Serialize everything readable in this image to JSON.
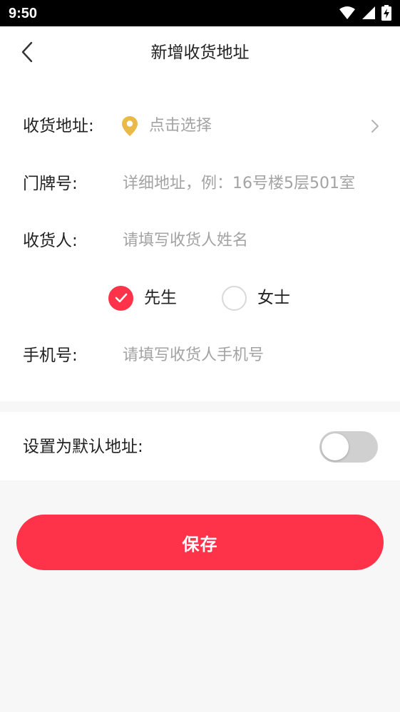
{
  "status_bar": {
    "time": "9:50",
    "icons": [
      "wifi-icon",
      "cell-signal-icon",
      "battery-charging-icon"
    ]
  },
  "header": {
    "back_icon": "chevron-left-icon",
    "title": "新增收货地址"
  },
  "form": {
    "address": {
      "label": "收货地址:",
      "icon": "location-pin-icon",
      "placeholder": "点击选择",
      "value": "",
      "arrow_icon": "chevron-right-icon"
    },
    "door": {
      "label": "门牌号:",
      "placeholder": "详细地址，例：16号楼5层501室",
      "value": ""
    },
    "recipient": {
      "label": "收货人:",
      "placeholder": "请填写收货人姓名",
      "value": ""
    },
    "gender": {
      "selected": "先生",
      "options": [
        "先生",
        "女士"
      ]
    },
    "phone": {
      "label": "手机号:",
      "placeholder": "请填写收货人手机号",
      "value": ""
    }
  },
  "default_address": {
    "label": "设置为默认地址:",
    "enabled": false
  },
  "save_button": {
    "label": "保存"
  },
  "colors": {
    "accent": "#fe3248",
    "pin": "#e9b949",
    "placeholder": "#a3a3a3",
    "page_background": "#f7f7f7",
    "toggle_off": "#d0d0d0"
  }
}
